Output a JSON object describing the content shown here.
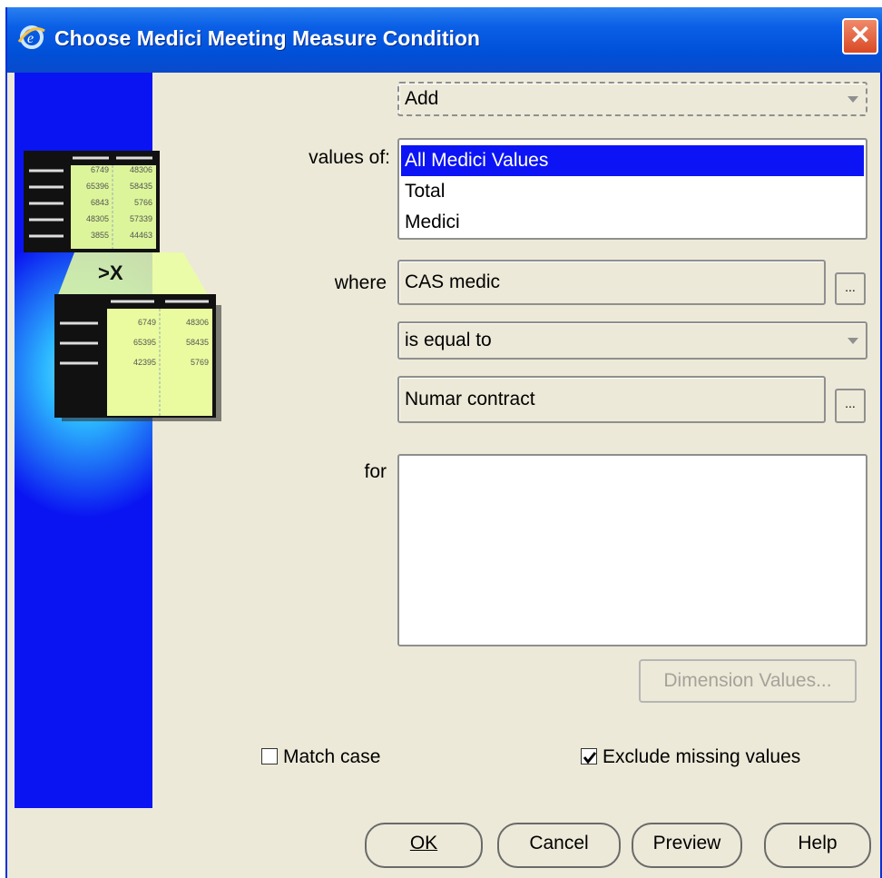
{
  "window": {
    "title": "Choose Medici Meeting Measure Condition",
    "close_glyph": "✕"
  },
  "operation_select": {
    "value": "Add"
  },
  "values_of": {
    "label": "values of:",
    "items": [
      "All Medici Values",
      "Total",
      "Medici"
    ],
    "selected_index": 0
  },
  "where": {
    "label": "where",
    "field_value": "CAS medic",
    "browse_label": "...",
    "operator_value": "is equal to",
    "compare_value": "Numar contract",
    "compare_browse_label": "..."
  },
  "for": {
    "label": "for"
  },
  "dimension_values_button": "Dimension Values...",
  "options": {
    "match_case": {
      "label": "Match case",
      "checked": false
    },
    "exclude_missing": {
      "label": "Exclude missing values",
      "checked": true
    }
  },
  "buttons": {
    "ok": "OK",
    "cancel": "Cancel",
    "preview": "Preview",
    "help": "Help"
  },
  "illustration": {
    "operator_text": ">X",
    "top_table": [
      [
        "6749",
        "48306"
      ],
      [
        "65396",
        "58435"
      ],
      [
        "6843",
        "5766"
      ],
      [
        "48305",
        "57339"
      ],
      [
        "3855",
        "44463"
      ]
    ],
    "bottom_table": [
      [
        "6749",
        "48306"
      ],
      [
        "65395",
        "58435"
      ],
      [
        "42395",
        "5769"
      ]
    ]
  },
  "colors": {
    "title_bar": "#0054e3",
    "selection": "#0c14f5",
    "dialog_bg": "#ece9d8",
    "banner": "#0a14f2"
  }
}
